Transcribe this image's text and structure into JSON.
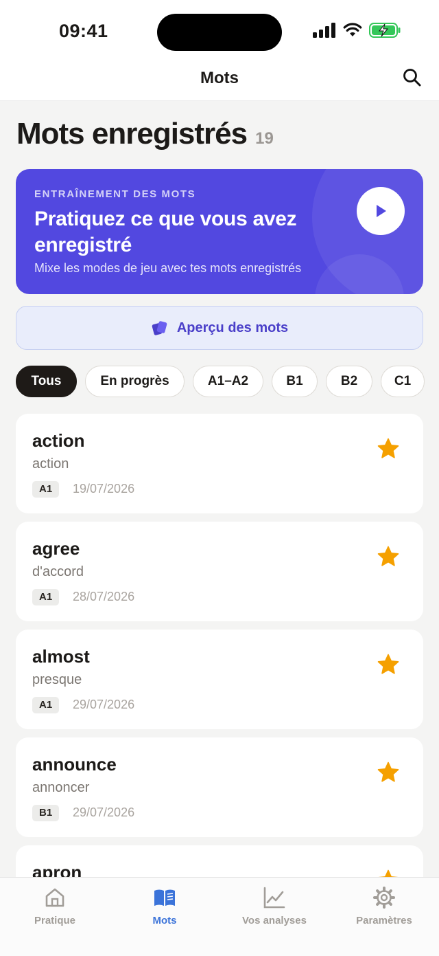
{
  "status_bar": {
    "time": "09:41"
  },
  "nav": {
    "title": "Mots"
  },
  "heading": {
    "title": "Mots enregistrés",
    "count": "19"
  },
  "practice_banner": {
    "kicker": "ENTRAÎNEMENT DES MOTS",
    "title": "Pratiquez ce que vous avez enregistré",
    "subtitle": "Mixe les modes de jeu avec tes mots enregistrés",
    "color": "#5248e0"
  },
  "overview_button": {
    "label": "Aperçu des mots"
  },
  "filters": [
    "Tous",
    "En progrès",
    "A1–A2",
    "B1",
    "B2",
    "C1"
  ],
  "words": [
    {
      "word": "action",
      "translation": "action",
      "level": "A1",
      "date": "19/07/2026"
    },
    {
      "word": "agree",
      "translation": "d'accord",
      "level": "A1",
      "date": "28/07/2026"
    },
    {
      "word": "almost",
      "translation": "presque",
      "level": "A1",
      "date": "29/07/2026"
    },
    {
      "word": "announce",
      "translation": "annoncer",
      "level": "B1",
      "date": "29/07/2026"
    },
    {
      "word": "apron",
      "translation": "",
      "level": "",
      "date": ""
    }
  ],
  "tabs": [
    {
      "label": "Pratique",
      "icon": "home-icon"
    },
    {
      "label": "Mots",
      "icon": "book-icon"
    },
    {
      "label": "Vos analyses",
      "icon": "chart-icon"
    },
    {
      "label": "Paramètres",
      "icon": "gear-icon"
    }
  ],
  "colors": {
    "accent": "#3b73d9",
    "star": "#f5a000",
    "banner": "#5248e0"
  }
}
